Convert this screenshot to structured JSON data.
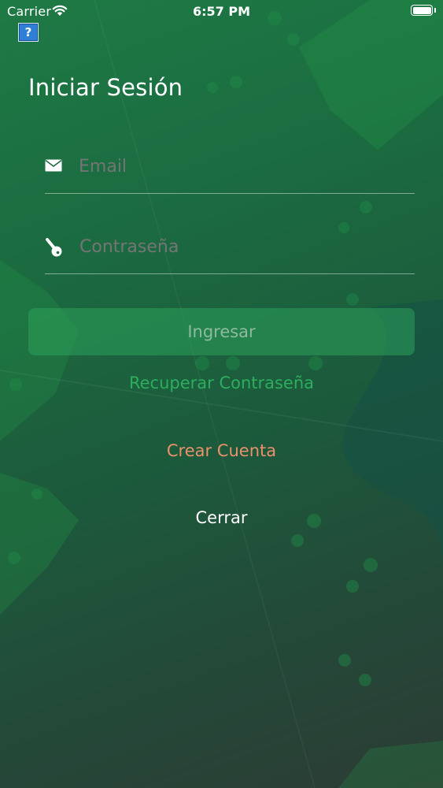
{
  "status_bar": {
    "carrier": "Carrier",
    "time": "6:57 PM",
    "wifi_icon": "wifi-icon",
    "battery_icon": "battery-icon"
  },
  "help": {
    "label": "?",
    "icon": "help-icon"
  },
  "title": "Iniciar Sesión",
  "form": {
    "email": {
      "value": "",
      "placeholder": "Email",
      "icon": "envelope-icon"
    },
    "password": {
      "value": "",
      "placeholder": "Contraseña",
      "icon": "key-icon"
    },
    "submit_label": "Ingresar"
  },
  "links": {
    "recover": "Recuperar Contraseña",
    "create": "Crear Cuenta",
    "close": "Cerrar"
  },
  "colors": {
    "background_top": "#1e7a45",
    "background_bottom": "#2c3c35",
    "accent_green": "#2cae5e",
    "create_orange": "#e8916a",
    "submit_button": "#2ca05a",
    "text": "#ffffff"
  }
}
